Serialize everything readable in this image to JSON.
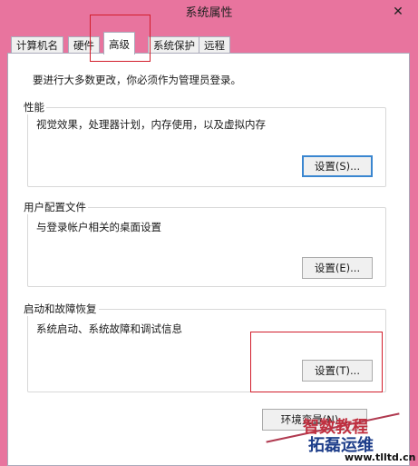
{
  "window": {
    "title": "系统属性",
    "close_glyph": "✕"
  },
  "tabs": [
    {
      "label": "计算机名"
    },
    {
      "label": "硬件"
    },
    {
      "label": "高级"
    },
    {
      "label": "系统保护"
    },
    {
      "label": "远程"
    }
  ],
  "admin_note": "要进行大多数更改，你必须作为管理员登录。",
  "performance": {
    "title": "性能",
    "desc": "视觉效果，处理器计划，内存使用，以及虚拟内存",
    "button": "设置(S)..."
  },
  "user_profiles": {
    "title": "用户配置文件",
    "desc": "与登录帐户相关的桌面设置",
    "button": "设置(E)..."
  },
  "startup_recovery": {
    "title": "启动和故障恢复",
    "desc": "系统启动、系统故障和调试信息",
    "button": "设置(T)..."
  },
  "env_button": "环境变量(N)...",
  "watermark": {
    "line1": "智数教程",
    "line2": "拓磊运维",
    "url": "www.tlltd.cn"
  },
  "colors": {
    "frame": "#e8749e",
    "annotation_red": "#d21e2c",
    "focus_blue": "#3a86d0"
  }
}
